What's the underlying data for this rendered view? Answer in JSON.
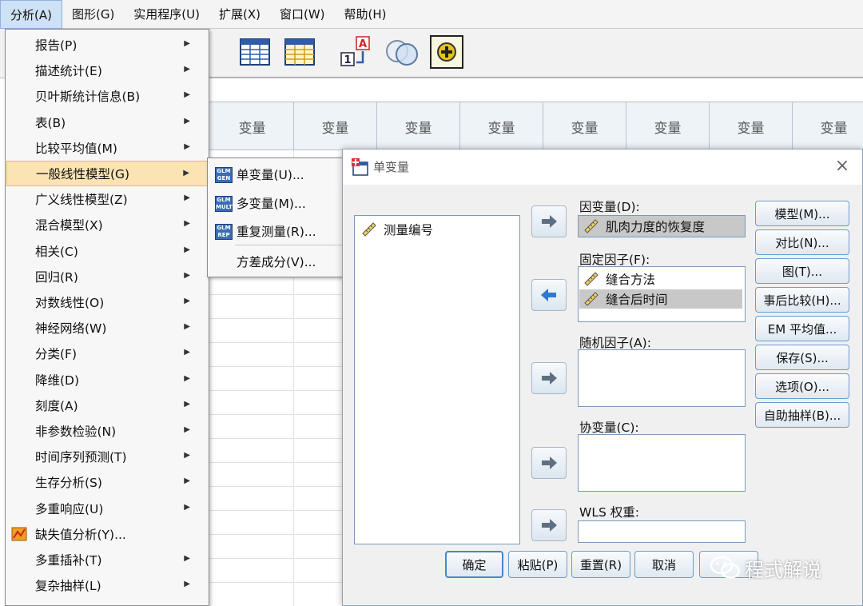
{
  "menubar": {
    "items": [
      "分析(A)",
      "图形(G)",
      "实用程序(U)",
      "扩展(X)",
      "窗口(W)",
      "帮助(H)"
    ],
    "active_index": 0
  },
  "grid": {
    "column_header": "变量",
    "column_count": 8
  },
  "analysis_menu": {
    "items": [
      {
        "label": "报告(P)",
        "submenu": true
      },
      {
        "label": "描述统计(E)",
        "submenu": true
      },
      {
        "label": "贝叶斯统计信息(B)",
        "submenu": true
      },
      {
        "label": "表(B)",
        "submenu": true
      },
      {
        "label": "比较平均值(M)",
        "submenu": true
      },
      {
        "label": "一般线性模型(G)",
        "submenu": true,
        "selected": true
      },
      {
        "label": "广义线性模型(Z)",
        "submenu": true
      },
      {
        "label": "混合模型(X)",
        "submenu": true
      },
      {
        "label": "相关(C)",
        "submenu": true
      },
      {
        "label": "回归(R)",
        "submenu": true
      },
      {
        "label": "对数线性(O)",
        "submenu": true
      },
      {
        "label": "神经网络(W)",
        "submenu": true
      },
      {
        "label": "分类(F)",
        "submenu": true
      },
      {
        "label": "降维(D)",
        "submenu": true
      },
      {
        "label": "刻度(A)",
        "submenu": true
      },
      {
        "label": "非参数检验(N)",
        "submenu": true
      },
      {
        "label": "时间序列预测(T)",
        "submenu": true
      },
      {
        "label": "生存分析(S)",
        "submenu": true
      },
      {
        "label": "多重响应(U)",
        "submenu": true
      },
      {
        "label": "缺失值分析(Y)...",
        "submenu": false,
        "icon": "missing-value-icon"
      },
      {
        "label": "多重插补(T)",
        "submenu": true
      },
      {
        "label": "复杂抽样(L)",
        "submenu": true
      }
    ]
  },
  "glm_submenu": {
    "items": [
      {
        "label": "单变量(U)...",
        "icon": "glm-univariate-icon",
        "badge": [
          "GLM",
          "GEN"
        ]
      },
      {
        "label": "多变量(M)...",
        "icon": "glm-multivariate-icon",
        "badge": [
          "GLM",
          "MULT"
        ]
      },
      {
        "label": "重复测量(R)...",
        "icon": "glm-repeated-icon",
        "badge": [
          "GLM",
          "REP"
        ]
      },
      {
        "label": "方差成分(V)...",
        "icon": "",
        "badge": []
      }
    ]
  },
  "dialog": {
    "title": "单变量",
    "source_list": [
      "测量编号"
    ],
    "dependent_label": "因变量(D):",
    "dependent_value": "肌肉力度的恢复度",
    "fixed_label": "固定因子(F):",
    "fixed_items": [
      "缝合方法",
      "缝合后时间"
    ],
    "random_label": "随机因子(A):",
    "covariate_label": "协变量(C):",
    "wls_label": "WLS 权重:",
    "side_buttons": [
      "模型(M)...",
      "对比(N)...",
      "图(T)...",
      "事后比较(H)...",
      "EM 平均值...",
      "保存(S)...",
      "选项(O)...",
      "自助抽样(B)..."
    ],
    "bottom_buttons": [
      "确定",
      "粘贴(P)",
      "重置(R)",
      "取消"
    ]
  },
  "watermark": {
    "text": "程式解说"
  },
  "colors": {
    "menu_selected": "#fbe3b4",
    "dialog_bg": "#f0f0f0",
    "button_border": "#6f9cc9"
  }
}
